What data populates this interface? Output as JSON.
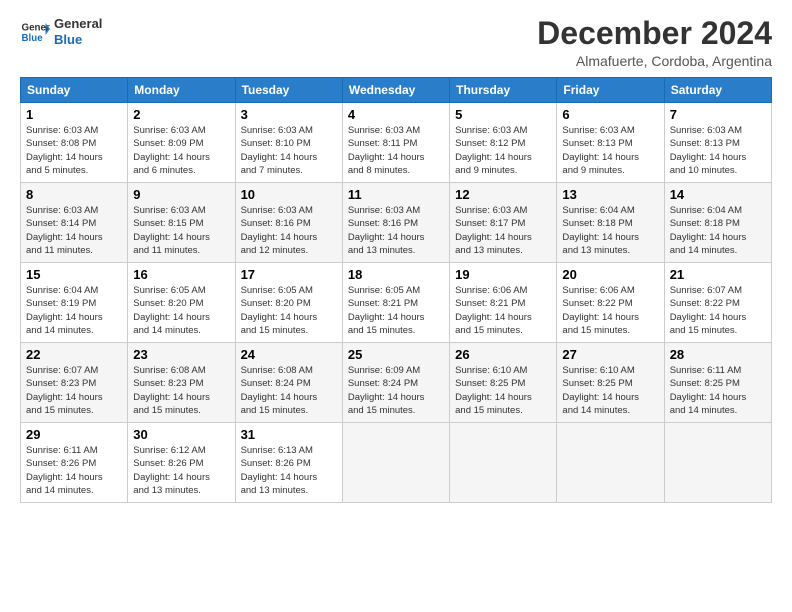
{
  "logo": {
    "line1": "General",
    "line2": "Blue"
  },
  "title": "December 2024",
  "location": "Almafuerte, Cordoba, Argentina",
  "days_of_week": [
    "Sunday",
    "Monday",
    "Tuesday",
    "Wednesday",
    "Thursday",
    "Friday",
    "Saturday"
  ],
  "weeks": [
    [
      {
        "day": 1,
        "info": "Sunrise: 6:03 AM\nSunset: 8:08 PM\nDaylight: 14 hours\nand 5 minutes."
      },
      {
        "day": 2,
        "info": "Sunrise: 6:03 AM\nSunset: 8:09 PM\nDaylight: 14 hours\nand 6 minutes."
      },
      {
        "day": 3,
        "info": "Sunrise: 6:03 AM\nSunset: 8:10 PM\nDaylight: 14 hours\nand 7 minutes."
      },
      {
        "day": 4,
        "info": "Sunrise: 6:03 AM\nSunset: 8:11 PM\nDaylight: 14 hours\nand 8 minutes."
      },
      {
        "day": 5,
        "info": "Sunrise: 6:03 AM\nSunset: 8:12 PM\nDaylight: 14 hours\nand 9 minutes."
      },
      {
        "day": 6,
        "info": "Sunrise: 6:03 AM\nSunset: 8:13 PM\nDaylight: 14 hours\nand 9 minutes."
      },
      {
        "day": 7,
        "info": "Sunrise: 6:03 AM\nSunset: 8:13 PM\nDaylight: 14 hours\nand 10 minutes."
      }
    ],
    [
      {
        "day": 8,
        "info": "Sunrise: 6:03 AM\nSunset: 8:14 PM\nDaylight: 14 hours\nand 11 minutes."
      },
      {
        "day": 9,
        "info": "Sunrise: 6:03 AM\nSunset: 8:15 PM\nDaylight: 14 hours\nand 11 minutes."
      },
      {
        "day": 10,
        "info": "Sunrise: 6:03 AM\nSunset: 8:16 PM\nDaylight: 14 hours\nand 12 minutes."
      },
      {
        "day": 11,
        "info": "Sunrise: 6:03 AM\nSunset: 8:16 PM\nDaylight: 14 hours\nand 13 minutes."
      },
      {
        "day": 12,
        "info": "Sunrise: 6:03 AM\nSunset: 8:17 PM\nDaylight: 14 hours\nand 13 minutes."
      },
      {
        "day": 13,
        "info": "Sunrise: 6:04 AM\nSunset: 8:18 PM\nDaylight: 14 hours\nand 13 minutes."
      },
      {
        "day": 14,
        "info": "Sunrise: 6:04 AM\nSunset: 8:18 PM\nDaylight: 14 hours\nand 14 minutes."
      }
    ],
    [
      {
        "day": 15,
        "info": "Sunrise: 6:04 AM\nSunset: 8:19 PM\nDaylight: 14 hours\nand 14 minutes."
      },
      {
        "day": 16,
        "info": "Sunrise: 6:05 AM\nSunset: 8:20 PM\nDaylight: 14 hours\nand 14 minutes."
      },
      {
        "day": 17,
        "info": "Sunrise: 6:05 AM\nSunset: 8:20 PM\nDaylight: 14 hours\nand 15 minutes."
      },
      {
        "day": 18,
        "info": "Sunrise: 6:05 AM\nSunset: 8:21 PM\nDaylight: 14 hours\nand 15 minutes."
      },
      {
        "day": 19,
        "info": "Sunrise: 6:06 AM\nSunset: 8:21 PM\nDaylight: 14 hours\nand 15 minutes."
      },
      {
        "day": 20,
        "info": "Sunrise: 6:06 AM\nSunset: 8:22 PM\nDaylight: 14 hours\nand 15 minutes."
      },
      {
        "day": 21,
        "info": "Sunrise: 6:07 AM\nSunset: 8:22 PM\nDaylight: 14 hours\nand 15 minutes."
      }
    ],
    [
      {
        "day": 22,
        "info": "Sunrise: 6:07 AM\nSunset: 8:23 PM\nDaylight: 14 hours\nand 15 minutes."
      },
      {
        "day": 23,
        "info": "Sunrise: 6:08 AM\nSunset: 8:23 PM\nDaylight: 14 hours\nand 15 minutes."
      },
      {
        "day": 24,
        "info": "Sunrise: 6:08 AM\nSunset: 8:24 PM\nDaylight: 14 hours\nand 15 minutes."
      },
      {
        "day": 25,
        "info": "Sunrise: 6:09 AM\nSunset: 8:24 PM\nDaylight: 14 hours\nand 15 minutes."
      },
      {
        "day": 26,
        "info": "Sunrise: 6:10 AM\nSunset: 8:25 PM\nDaylight: 14 hours\nand 15 minutes."
      },
      {
        "day": 27,
        "info": "Sunrise: 6:10 AM\nSunset: 8:25 PM\nDaylight: 14 hours\nand 14 minutes."
      },
      {
        "day": 28,
        "info": "Sunrise: 6:11 AM\nSunset: 8:25 PM\nDaylight: 14 hours\nand 14 minutes."
      }
    ],
    [
      {
        "day": 29,
        "info": "Sunrise: 6:11 AM\nSunset: 8:26 PM\nDaylight: 14 hours\nand 14 minutes."
      },
      {
        "day": 30,
        "info": "Sunrise: 6:12 AM\nSunset: 8:26 PM\nDaylight: 14 hours\nand 13 minutes."
      },
      {
        "day": 31,
        "info": "Sunrise: 6:13 AM\nSunset: 8:26 PM\nDaylight: 14 hours\nand 13 minutes."
      },
      null,
      null,
      null,
      null
    ]
  ]
}
